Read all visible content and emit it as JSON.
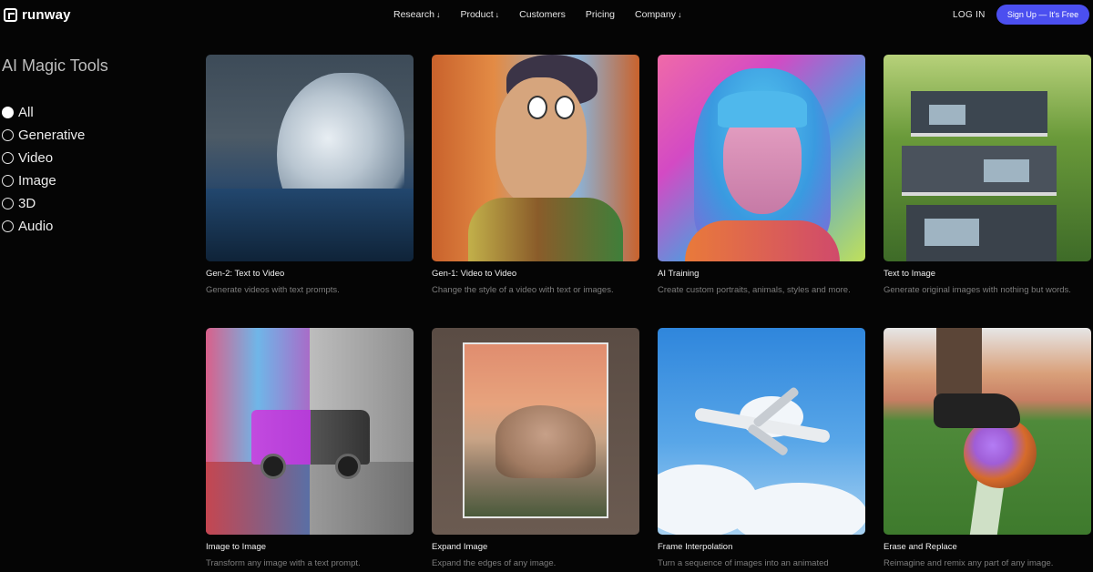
{
  "brand": {
    "name": "runway"
  },
  "nav": [
    {
      "label": "Research",
      "has_dropdown": true
    },
    {
      "label": "Product",
      "has_dropdown": true
    },
    {
      "label": "Customers",
      "has_dropdown": false
    },
    {
      "label": "Pricing",
      "has_dropdown": false
    },
    {
      "label": "Company",
      "has_dropdown": true
    }
  ],
  "auth": {
    "login": "LOG IN",
    "signup": "Sign Up — It's Free"
  },
  "sidebar": {
    "title": "AI Magic Tools",
    "filters": [
      {
        "label": "All",
        "selected": true
      },
      {
        "label": "Generative",
        "selected": false
      },
      {
        "label": "Video",
        "selected": false
      },
      {
        "label": "Image",
        "selected": false
      },
      {
        "label": "3D",
        "selected": false
      },
      {
        "label": "Audio",
        "selected": false
      }
    ]
  },
  "tools": [
    {
      "title": "Gen-2: Text to Video",
      "desc": "Generate videos with text prompts.",
      "thumb": "stormy-wave-image"
    },
    {
      "title": "Gen-1: Video to Video",
      "desc": "Change the style of a video with text or images.",
      "thumb": "clay-character-image"
    },
    {
      "title": "AI Training",
      "desc": "Create custom portraits, animals, styles and more.",
      "thumb": "neon-portrait-image"
    },
    {
      "title": "Text to Image",
      "desc": "Generate original images with nothing but words.",
      "thumb": "modern-house-image"
    },
    {
      "title": "Image to Image",
      "desc": "Transform any image with a text prompt.",
      "thumb": "split-car-image"
    },
    {
      "title": "Expand Image",
      "desc": "Expand the edges of any image.",
      "thumb": "desert-rock-image"
    },
    {
      "title": "Frame Interpolation",
      "desc": "Turn a sequence of images into an animated",
      "thumb": "airplane-sky-image"
    },
    {
      "title": "Erase and Replace",
      "desc": "Reimagine and remix any part of any image.",
      "thumb": "soccer-ball-image"
    }
  ],
  "colors": {
    "background": "#050505",
    "accent": "#4b4ff0",
    "muted_text": "#7d7d7d"
  }
}
